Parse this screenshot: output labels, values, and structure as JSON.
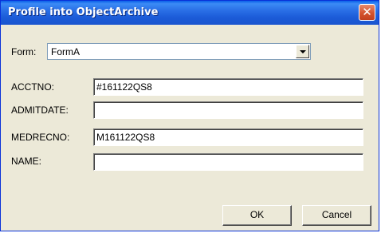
{
  "window": {
    "title": "Profile into ObjectArchive",
    "close_symbol": "✕"
  },
  "form": {
    "label": "Form:",
    "selected": "FormA"
  },
  "fields": [
    {
      "label": "ACCTNO:",
      "value": "#161122QS8"
    },
    {
      "label": "ADMITDATE:",
      "value": ""
    },
    {
      "label": "MEDRECNO:",
      "value": "M161122QS8"
    },
    {
      "label": "NAME:",
      "value": ""
    }
  ],
  "buttons": {
    "ok": "OK",
    "cancel": "Cancel"
  }
}
